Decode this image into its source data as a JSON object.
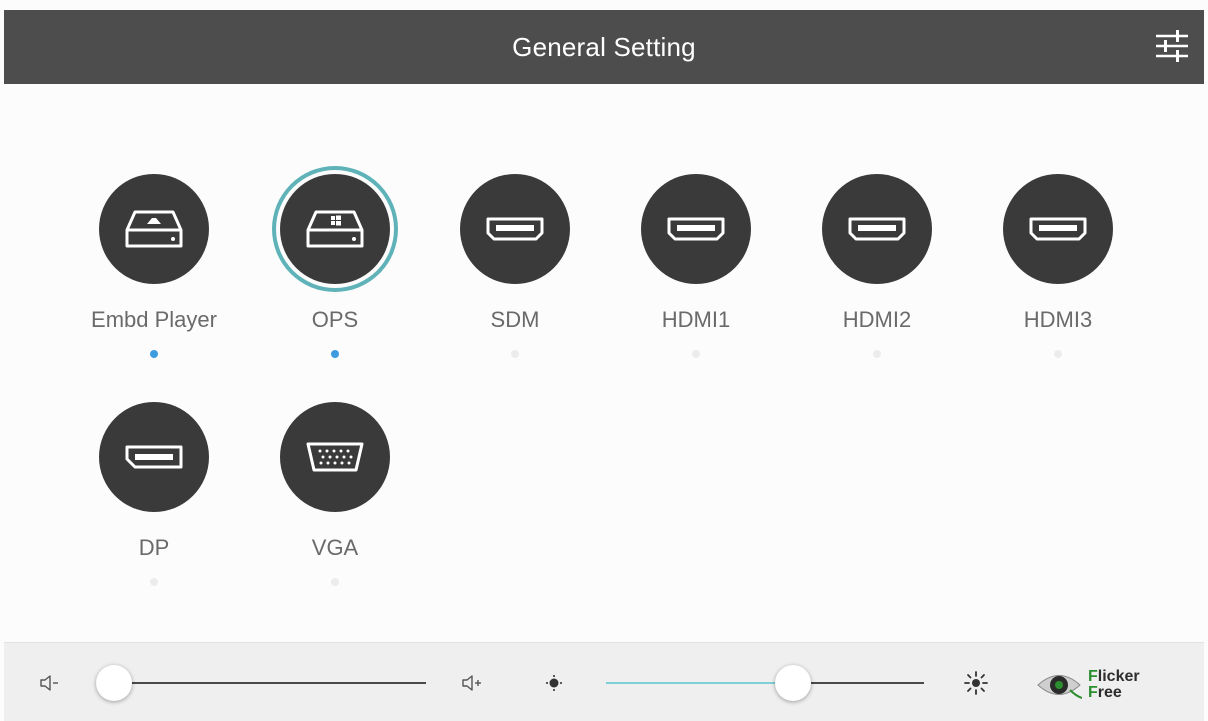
{
  "header": {
    "title": "General Setting",
    "settings_icon": "sliders-icon"
  },
  "sources": [
    {
      "label": "Embd Player",
      "icon": "drive-icon",
      "selected": false,
      "signal": true
    },
    {
      "label": "OPS",
      "icon": "windows-drive-icon",
      "selected": true,
      "signal": true
    },
    {
      "label": "SDM",
      "icon": "hdmi-icon",
      "selected": false,
      "signal": false
    },
    {
      "label": "HDMI1",
      "icon": "hdmi-icon",
      "selected": false,
      "signal": false
    },
    {
      "label": "HDMI2",
      "icon": "hdmi-icon",
      "selected": false,
      "signal": false
    },
    {
      "label": "HDMI3",
      "icon": "hdmi-icon",
      "selected": false,
      "signal": false
    },
    {
      "label": "DP",
      "icon": "displayport-icon",
      "selected": false,
      "signal": false
    },
    {
      "label": "VGA",
      "icon": "vga-icon",
      "selected": false,
      "signal": false
    }
  ],
  "bottom": {
    "volume": {
      "value": 0,
      "min_icon": "volume-down-icon",
      "max_icon": "volume-up-icon"
    },
    "brightness": {
      "value": 0.6,
      "min_icon": "brightness-low-icon",
      "max_icon": "brightness-high-icon"
    },
    "logo": {
      "line1_first": "F",
      "line1_rest": "licker",
      "line2_first": "F",
      "line2_rest": "ree"
    }
  },
  "colors": {
    "header_bg": "#4d4d4d",
    "selected_ring": "#5fb3b8",
    "signal_dot": "#3d9be0",
    "slider_fill": "#7fd0d6"
  }
}
